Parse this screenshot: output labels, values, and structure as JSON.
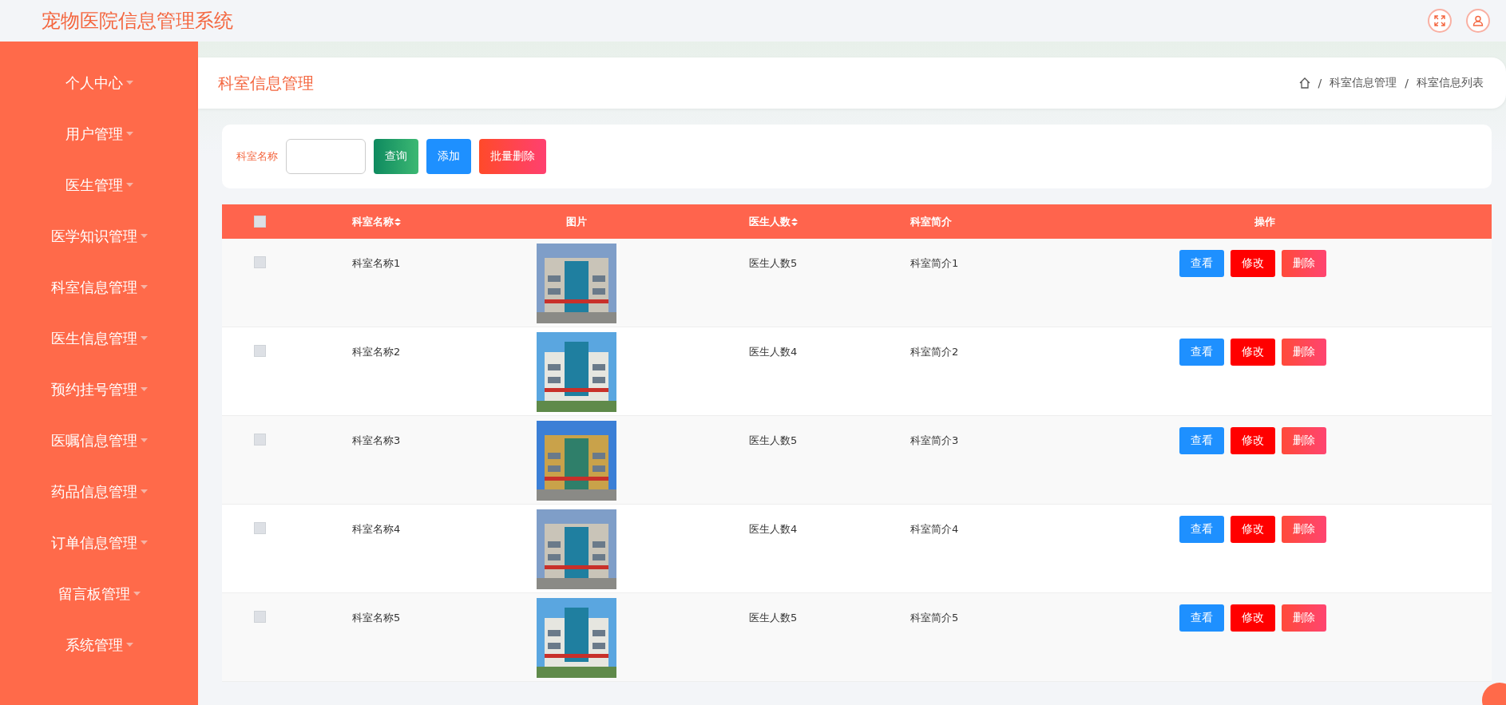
{
  "app_title": "宠物医院信息管理系统",
  "sidebar": {
    "items": [
      {
        "label": "个人中心"
      },
      {
        "label": "用户管理"
      },
      {
        "label": "医生管理"
      },
      {
        "label": "医学知识管理"
      },
      {
        "label": "科室信息管理"
      },
      {
        "label": "医生信息管理"
      },
      {
        "label": "预约挂号管理"
      },
      {
        "label": "医嘱信息管理"
      },
      {
        "label": "药品信息管理"
      },
      {
        "label": "订单信息管理"
      },
      {
        "label": "留言板管理"
      },
      {
        "label": "系统管理"
      }
    ]
  },
  "page_title": "科室信息管理",
  "breadcrumb": [
    "科室信息管理",
    "科室信息列表"
  ],
  "breadcrumb_separator": "/",
  "search": {
    "label": "科室名称",
    "buttons": [
      {
        "label": "查询",
        "kind": "search"
      },
      {
        "label": "添加",
        "kind": "add"
      },
      {
        "label": "批量删除",
        "kind": "delete"
      }
    ]
  },
  "table": {
    "select_all_checked": false,
    "columns": [
      {
        "label": "科室名称",
        "sortable": true
      },
      {
        "label": "图片",
        "sortable": false
      },
      {
        "label": "医生人数",
        "sortable": true
      },
      {
        "label": "科室简介",
        "sortable": false
      },
      {
        "label": "操作",
        "sortable": false
      }
    ],
    "rows": [
      {
        "checked": false,
        "name": "科室名称1",
        "doctors": "医生人数5",
        "intro": "科室简介1",
        "actions": [
          "查看",
          "修改",
          "删除"
        ]
      },
      {
        "checked": false,
        "name": "科室名称2",
        "doctors": "医生人数4",
        "intro": "科室简介2",
        "actions": [
          "查看",
          "修改",
          "删除"
        ]
      },
      {
        "checked": false,
        "name": "科室名称3",
        "doctors": "医生人数5",
        "intro": "科室简介3",
        "actions": [
          "查看",
          "修改",
          "删除"
        ]
      },
      {
        "checked": false,
        "name": "科室名称4",
        "doctors": "医生人数4",
        "intro": "科室简介4",
        "actions": [
          "查看",
          "修改",
          "删除"
        ]
      },
      {
        "checked": false,
        "name": "科室名称5",
        "doctors": "医生人数5",
        "intro": "科室简介5",
        "actions": [
          "查看",
          "修改",
          "删除"
        ]
      }
    ]
  }
}
